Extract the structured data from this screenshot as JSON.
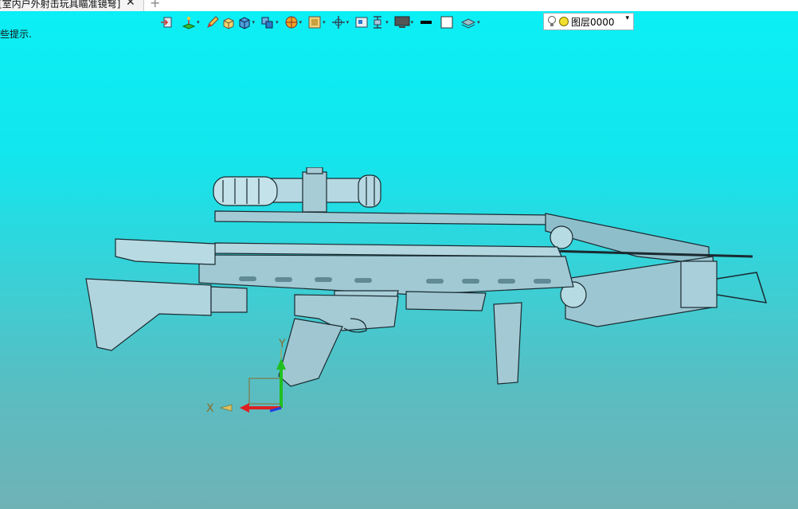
{
  "tab": {
    "title": "[室内户外射击玩具瞄准镜弩]",
    "close_glyph": "✕",
    "add_glyph": "+"
  },
  "toolbar": {
    "icons": [
      "exit-sketch-icon",
      "sketch-plane-icon",
      "pencil-icon",
      "box-color-icon",
      "solid-cube-icon",
      "multi-cube-icon",
      "sphere-section-icon",
      "face-display-icon",
      "move-cursor-icon",
      "view-frame-icon",
      "vertical-split-icon",
      "monitor-icon",
      "black-line-icon",
      "white-square-icon",
      "layer-stack-icon"
    ],
    "dropdown_glyph": "▾"
  },
  "layer_select": {
    "value": "图层0000",
    "arrow": "▾"
  },
  "hint": "些提示.",
  "axes": {
    "x_label": "X",
    "y_label": "Y"
  },
  "colors": {
    "bg_top": "#0af0f6",
    "bg_bottom": "#6fb2b6",
    "model_fill": "#9cc9d4",
    "model_stroke": "#1a2a30",
    "axis_x": "#e02020",
    "axis_y": "#20c020",
    "axis_z": "#2040e0"
  }
}
